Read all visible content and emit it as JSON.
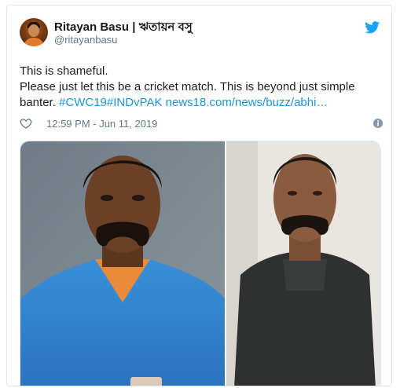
{
  "tweet": {
    "author_name": "Ritayan Basu | ঋতায়ন বসু",
    "author_handle": "@ritayanbasu",
    "text_line1": "This is shameful.",
    "text_line2": "Please just let this be a cricket match. This is beyond just simple banter.",
    "hashtag1": "#CWC19",
    "hashtag2": "#INDvPAK",
    "link": "news18.com/news/buzz/abhi…",
    "timestamp": "12:59 PM - Jun 11, 2019"
  },
  "icons": {
    "platform": "twitter-bird-icon",
    "like": "heart-icon",
    "info": "info-icon"
  },
  "colors": {
    "link": "#1b95e0",
    "twitter_blue": "#1da1f2",
    "secondary_text": "#657786"
  },
  "media": {
    "left_photo": "cricketer-in-blue-jersey-photo",
    "right_photo": "man-in-dark-sweater-photo"
  }
}
